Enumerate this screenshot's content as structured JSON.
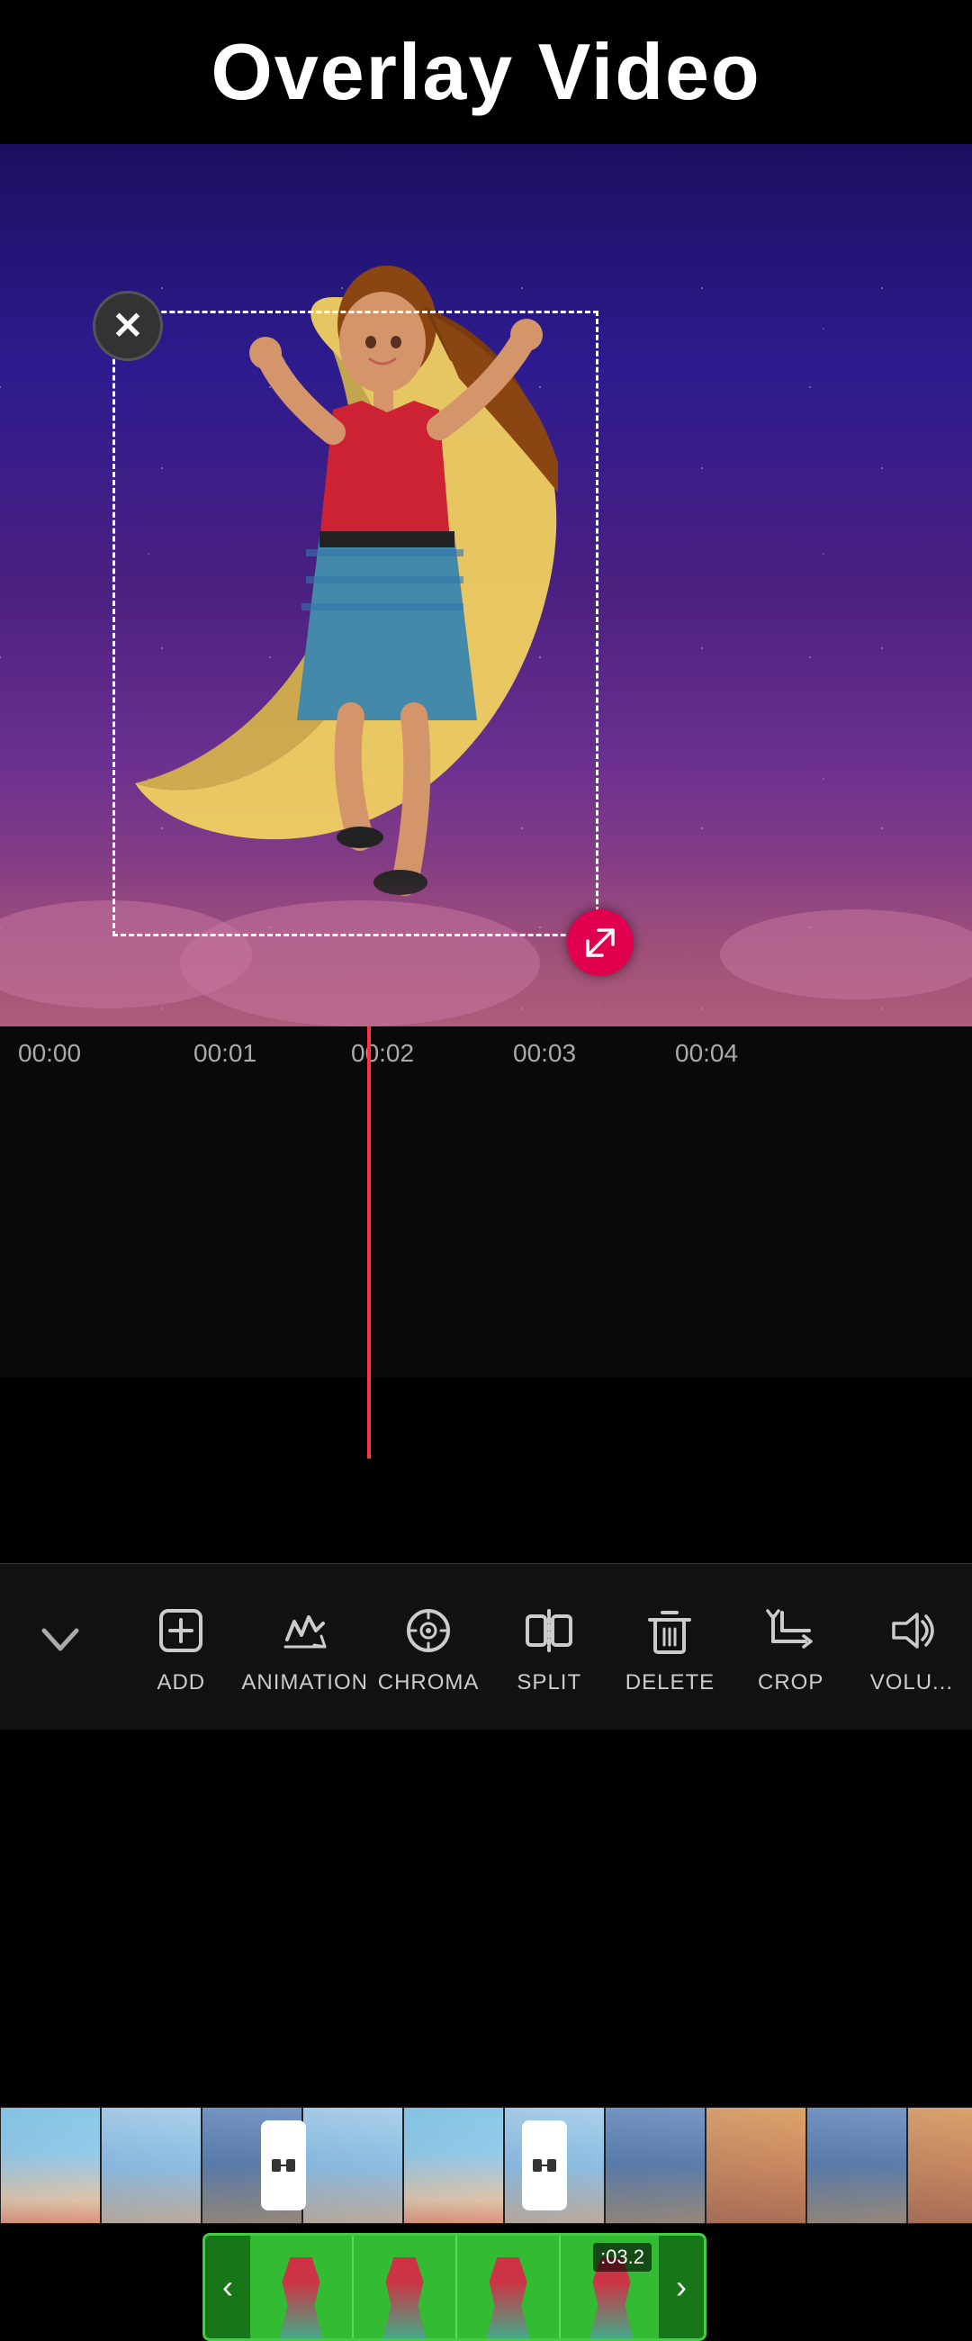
{
  "header": {
    "title": "Overlay Video"
  },
  "preview": {
    "close_label": "✕"
  },
  "timeline": {
    "markers": [
      "00:00",
      "00:01",
      "00:02",
      "00:03",
      "00:04"
    ],
    "overlay_duration": ":03.2"
  },
  "toolbar": {
    "items": [
      {
        "id": "collapse",
        "label": "",
        "icon": "chevron-down"
      },
      {
        "id": "add",
        "label": "ADD",
        "icon": "add-overlay"
      },
      {
        "id": "animation",
        "label": "ANIMATION",
        "icon": "animation"
      },
      {
        "id": "chroma",
        "label": "CHROMA",
        "icon": "chroma"
      },
      {
        "id": "split",
        "label": "SPLIT",
        "icon": "split"
      },
      {
        "id": "delete",
        "label": "DELETE",
        "icon": "delete"
      },
      {
        "id": "crop",
        "label": "CROP",
        "icon": "crop"
      },
      {
        "id": "volume",
        "label": "VOLU...",
        "icon": "volume"
      }
    ]
  }
}
